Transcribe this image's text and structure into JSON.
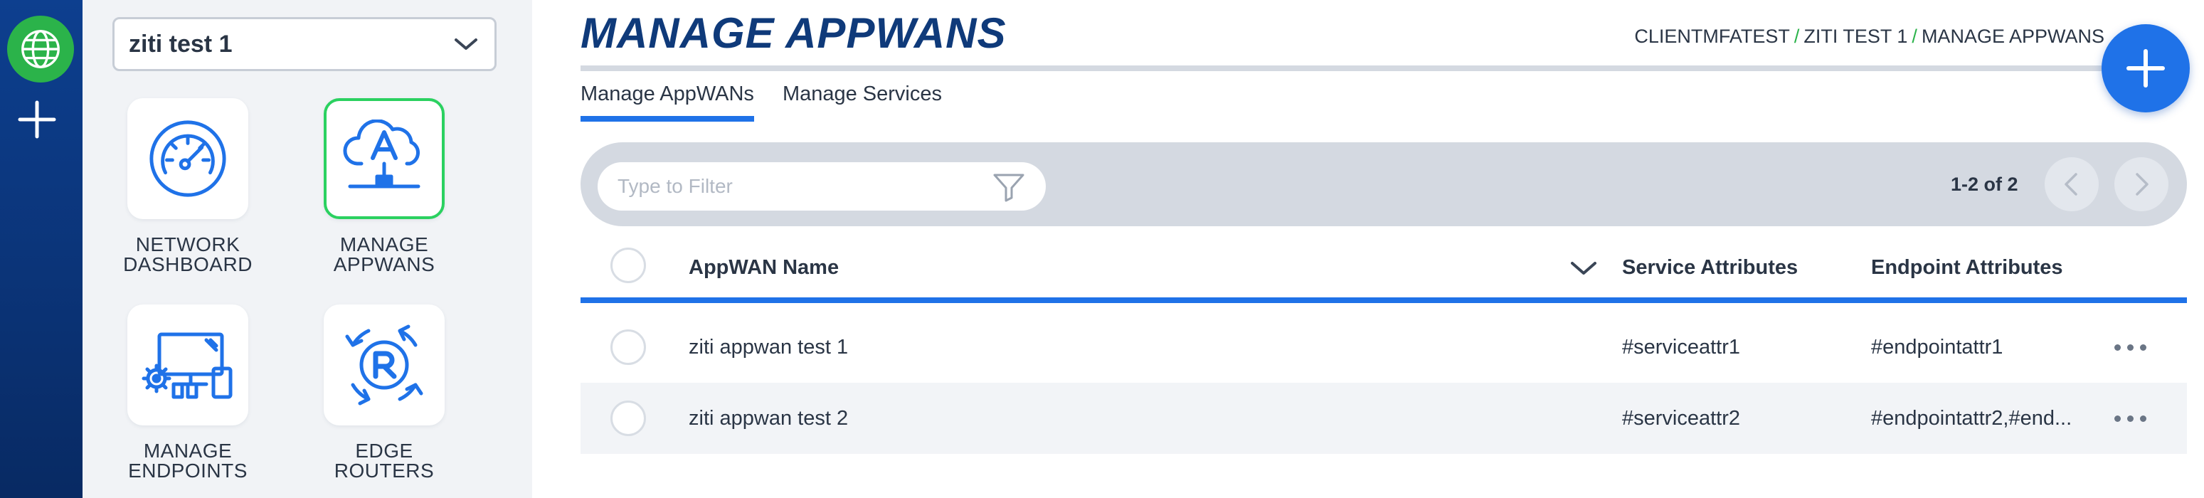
{
  "network": {
    "selected": "ziti test 1"
  },
  "nav_tiles": [
    {
      "line1": "NETWORK",
      "line2": "DASHBOARD",
      "icon": "gauge-icon"
    },
    {
      "line1": "MANAGE",
      "line2": "APPWANS",
      "icon": "cloud-appwan-icon"
    },
    {
      "line1": "MANAGE",
      "line2": "ENDPOINTS",
      "icon": "endpoints-icon"
    },
    {
      "line1": "EDGE",
      "line2": "ROUTERS",
      "icon": "router-icon"
    }
  ],
  "page": {
    "title": "MANAGE APPWANS"
  },
  "breadcrumb": {
    "items": [
      "CLIENTMFATEST",
      "ZITI TEST 1",
      "MANAGE APPWANS"
    ]
  },
  "tabs": [
    {
      "label": "Manage AppWANs",
      "active": true
    },
    {
      "label": "Manage Services",
      "active": false
    }
  ],
  "filter": {
    "placeholder": "Type to Filter"
  },
  "pager": {
    "text": "1-2 of 2"
  },
  "table": {
    "headers": {
      "name": "AppWAN Name",
      "service": "Service Attributes",
      "endpoint": "Endpoint Attributes"
    },
    "rows": [
      {
        "name": "ziti appwan test 1",
        "service": "#serviceattr1",
        "endpoint": "#endpointattr1"
      },
      {
        "name": "ziti appwan test 2",
        "service": "#serviceattr2",
        "endpoint": "#endpointattr2,#end..."
      }
    ]
  },
  "colors": {
    "accent": "#1f72e8",
    "brand_dark": "#0f3a7a",
    "success": "#2bb34a",
    "active_tile": "#2bd160"
  }
}
